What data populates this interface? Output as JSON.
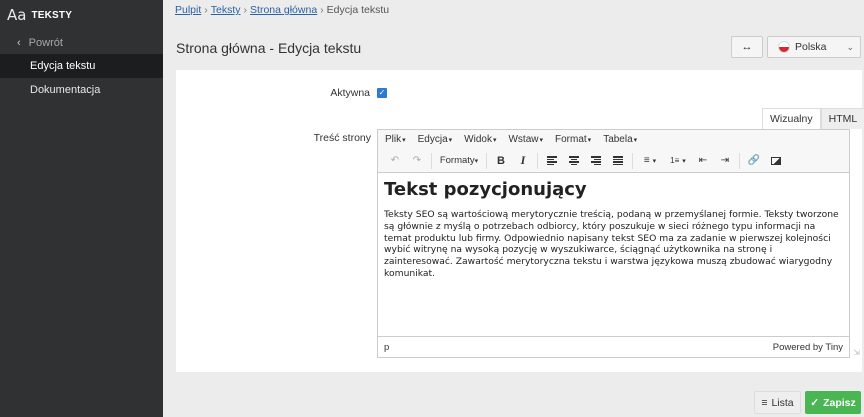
{
  "app": {
    "logo_glyph": "Aa",
    "title": "TEKSTY"
  },
  "sidebar": {
    "back_label": "Powrót",
    "items": [
      {
        "label": "Edycja tekstu",
        "active": true
      },
      {
        "label": "Dokumentacja",
        "active": false
      }
    ]
  },
  "breadcrumb": {
    "items": [
      "Pulpit",
      "Teksty",
      "Strona główna"
    ],
    "current": "Edycja tekstu",
    "separator": "›"
  },
  "header": {
    "title": "Strona główna - Edycja tekstu",
    "expand_icon": "arrows-horizontal-icon",
    "language": "Polska"
  },
  "form": {
    "active_label": "Aktywna",
    "active_checked": true,
    "content_label": "Treść strony",
    "editor_tabs": [
      "Wizualny",
      "HTML"
    ],
    "active_tab": "Wizualny"
  },
  "editor": {
    "menu": [
      "Plik",
      "Edycja",
      "Widok",
      "Wstaw",
      "Format",
      "Tabela"
    ],
    "formats_label": "Formaty",
    "heading": "Tekst pozycjonujący",
    "paragraph": "Teksty SEO są wartościową merytorycznie treścią, podaną w przemyślanej formie. Teksty tworzone są głównie z myślą o potrzebach odbiorcy, który poszukuje w sieci różnego typu informacji na temat produktu lub firmy. Odpowiednio napisany tekst SEO ma za zadanie w pierwszej kolejności wybić witrynę na wysoką pozycję w wyszukiwarce, ściągnąć użytkownika na stronę i zainteresować. Zawartość merytoryczna tekstu i warstwa językowa muszą zbudować wiarygodny komunikat.",
    "status_path": "p",
    "powered_by": "Powered by Tiny"
  },
  "footer": {
    "list_label": "Lista",
    "save_label": "Zapisz"
  },
  "colors": {
    "sidebar_bg": "#2f3133",
    "accent": "#2e7ad1",
    "save": "#49b653",
    "link": "#2a62a3"
  }
}
